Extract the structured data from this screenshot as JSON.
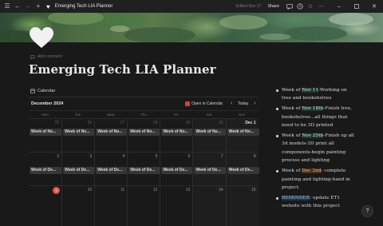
{
  "topbar": {
    "title": "Emerging Tech LIA Planner",
    "edited": "Edited Nov 17",
    "share": "Share",
    "icons": [
      "sidebar-icon",
      "back-icon",
      "forward-icon",
      "add-icon",
      "heart-icon",
      "comment-icon",
      "history-icon",
      "star-icon",
      "more-icon",
      "minimize-icon",
      "maximize-icon",
      "close-icon"
    ]
  },
  "page": {
    "add_comment": "Add comment",
    "title": "Emerging Tech LIA Planner"
  },
  "calendar": {
    "view_label": "Calendar",
    "month": "December 2024",
    "open_in_calendar": "Open in Calendar",
    "today": "Today",
    "weekdays": [
      "Mon",
      "Tue",
      "Wed",
      "Thu",
      "Fri",
      "Sat",
      "Sun"
    ],
    "weeks": [
      {
        "days": [
          {
            "num": "25",
            "style": "muted",
            "event": "Week of No..."
          },
          {
            "num": "26",
            "style": "muted",
            "event": "Week of No..."
          },
          {
            "num": "27",
            "style": "muted",
            "event": "Week of No..."
          },
          {
            "num": "28",
            "style": "muted",
            "event": "Week of No..."
          },
          {
            "num": "29",
            "style": "muted",
            "event": "Week of No..."
          },
          {
            "num": "30",
            "style": "muted",
            "event": "Week of No..."
          },
          {
            "num": "Dec 1",
            "style": "strong",
            "event": "Week of No..."
          }
        ]
      },
      {
        "days": [
          {
            "num": "2",
            "style": "",
            "event": "Week of De..."
          },
          {
            "num": "3",
            "style": "",
            "event": "Week of De..."
          },
          {
            "num": "4",
            "style": "",
            "event": "Week of De..."
          },
          {
            "num": "5",
            "style": "",
            "event": "Week of De..."
          },
          {
            "num": "6",
            "style": "",
            "event": "Week of De..."
          },
          {
            "num": "7",
            "style": "",
            "event": "Week of De..."
          },
          {
            "num": "8",
            "style": "",
            "event": "Week of De..."
          }
        ]
      },
      {
        "days": [
          {
            "num": "9",
            "style": "today",
            "event": ""
          },
          {
            "num": "10",
            "style": "",
            "event": ""
          },
          {
            "num": "11",
            "style": "",
            "event": ""
          },
          {
            "num": "12",
            "style": "",
            "event": ""
          },
          {
            "num": "13",
            "style": "",
            "event": ""
          },
          {
            "num": "14",
            "style": "",
            "event": ""
          },
          {
            "num": "15",
            "style": "",
            "event": ""
          }
        ]
      }
    ]
  },
  "notes": [
    {
      "parts": [
        {
          "t": "Week of "
        },
        {
          "t": "Nov 11",
          "hl": "green"
        },
        {
          "t": "-Working on tree and bookshelves"
        }
      ]
    },
    {
      "parts": [
        {
          "t": "Week of "
        },
        {
          "t": "Nov 18th",
          "hl": "green"
        },
        {
          "t": "-Finish tree, bookshelves...all things that need to be 3D printed"
        }
      ]
    },
    {
      "parts": [
        {
          "t": "Week of "
        },
        {
          "t": "Nov 25th",
          "hl": "green"
        },
        {
          "t": "-Finish up all 3d models-3D print all components-begin painting process and lighting"
        }
      ]
    },
    {
      "parts": [
        {
          "t": "Week of "
        },
        {
          "t": "Dec 2nd",
          "hl": "orange"
        },
        {
          "t": "- complete painting and lighting-hand in project."
        }
      ]
    },
    {
      "parts": [
        {
          "t": "REMINDER",
          "hl": "blue"
        },
        {
          "t": ": update ET1 website with this project"
        }
      ]
    }
  ],
  "help": "?",
  "colors": {
    "background": "#191919",
    "topbar": "#202020",
    "today_badge": "#e5534b",
    "event_chip": "#373737",
    "highlight_green": "#1f3a30",
    "highlight_orange": "#4a2e1c",
    "highlight_blue": "#203447"
  }
}
